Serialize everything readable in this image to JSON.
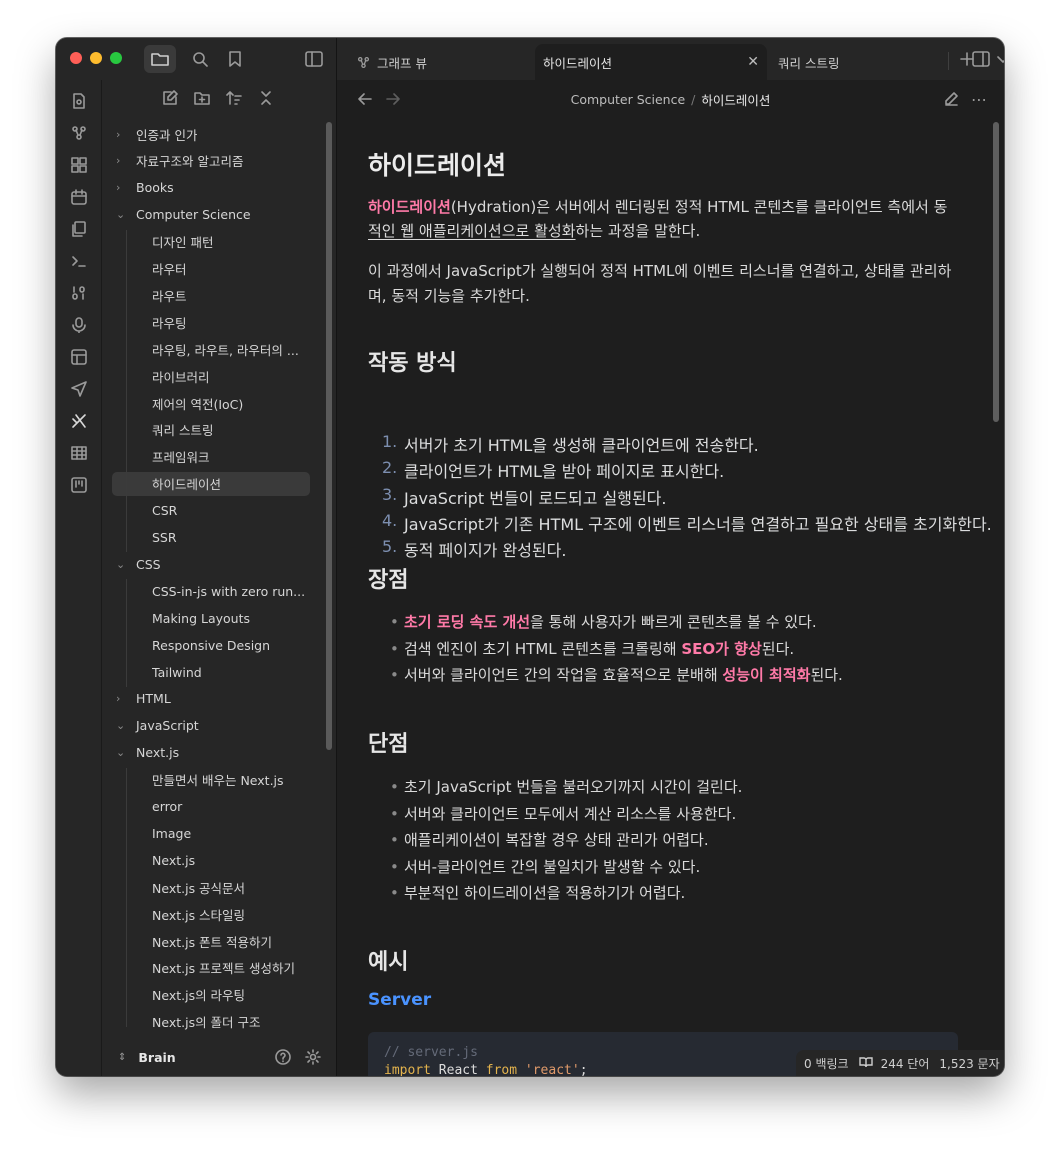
{
  "tabs": [
    {
      "label": "그래프 뷰",
      "icon": "graph-icon"
    },
    {
      "label": "하이드레이션",
      "active": true
    },
    {
      "label": "쿼리 스트링"
    }
  ],
  "breadcrumb": {
    "parent": "Computer Science",
    "separator": "/",
    "current": "하이드레이션"
  },
  "tree": {
    "folders_top": [
      {
        "label": "인증과 인가",
        "expanded": false
      },
      {
        "label": "자료구조와 알고리즘",
        "expanded": false
      },
      {
        "label": "Books",
        "expanded": false
      },
      {
        "label": "Computer Science",
        "expanded": true
      }
    ],
    "cs_files": [
      "디자인 패턴",
      "라우터",
      "라우트",
      "라우팅",
      "라우팅, 라우트, 라우터의 ...",
      "라이브러리",
      "제어의 역전(IoC)",
      "쿼리 스트링",
      "프레임워크",
      "하이드레이션",
      "CSR",
      "SSR"
    ],
    "css_folder": "CSS",
    "css_files": [
      "CSS-in-js with zero run...",
      "Making Layouts",
      "Responsive Design",
      "Tailwind"
    ],
    "html_folder": "HTML",
    "js_folder": "JavaScript",
    "next_folder": "Next.js",
    "next_files": [
      "만들면서 배우는 Next.js",
      "error",
      "Image",
      "Next.js",
      "Next.js 공식문서",
      "Next.js 스타일링",
      "Next.js 폰트 적용하기",
      "Next.js 프로젝트 생성하기",
      "Next.js의 라우팅",
      "Next.js의 폴더 구조"
    ]
  },
  "vault": {
    "name": "Brain"
  },
  "doc": {
    "title": "하이드레이션",
    "intro": {
      "hl": "하이드레이션",
      "line1_rest": "(Hydration)은 서버에서 렌더링된 정적 HTML  콘텐츠를 클라이언트 측에서 동",
      "line2_ul": "적인 웹 애플리케이션으로 활성화",
      "line2_rest": "하는 과정을 말한다."
    },
    "para2_line1": "이 과정에서 JavaScript가 실행되어 정적 HTML에 이벤트 리스너를 연결하고, 상태를 관리하",
    "para2_line2": "며, 동적 기능을 추가한다.",
    "how_title": "작동 방식",
    "how_steps": [
      "서버가 초기 HTML을 생성해 클라이언트에 전송한다.",
      "클라이언트가 HTML을 받아 페이지로 표시한다.",
      "JavaScript 번들이 로드되고 실행된다.",
      "JavaScript가 기존 HTML 구조에 이벤트 리스너를 연결하고 필요한 상태를 초기화한다.",
      "동적 페이지가 완성된다."
    ],
    "pros_title": "장점",
    "pros": [
      {
        "hl": "초기 로딩 속도 개선",
        "rest": "을 통해 사용자가 빠르게 콘텐츠를 볼 수 있다."
      },
      {
        "pre": "검색 엔진이 초기 HTML 콘텐츠를 크롤링해 ",
        "hl": "SEO가 향상",
        "rest": "된다."
      },
      {
        "pre": "서버와 클라이언트 간의 작업을 효율적으로 분배해 ",
        "hl": "성능이 최적화",
        "rest": "된다."
      }
    ],
    "cons_title": "단점",
    "cons": [
      "초기 JavaScript 번들을 불러오기까지 시간이 걸린다.",
      "서버와 클라이언트 모두에서 계산 리소스를 사용한다.",
      "애플리케이션이 복잡할 경우 상태 관리가 어렵다.",
      "서버-클라이언트 간의 불일치가 발생할 수 있다.",
      "부분적인 하이드레이션을 적용하기가 어렵다."
    ],
    "example_title": "예시",
    "server_title": "Server",
    "code_comment": "// server.js",
    "code_kw1": "import",
    "code_id": "React",
    "code_kw2": "from",
    "code_str": "'react'",
    "code_end": ";"
  },
  "status": {
    "backlinks": "0 백링크",
    "words": "244 단어",
    "chars": "1,523 문자"
  },
  "colors": {
    "accent_pink": "#ff7aa8",
    "accent_blue": "#4a93ff",
    "bg": "#1e1e1e",
    "panel": "#262626"
  }
}
